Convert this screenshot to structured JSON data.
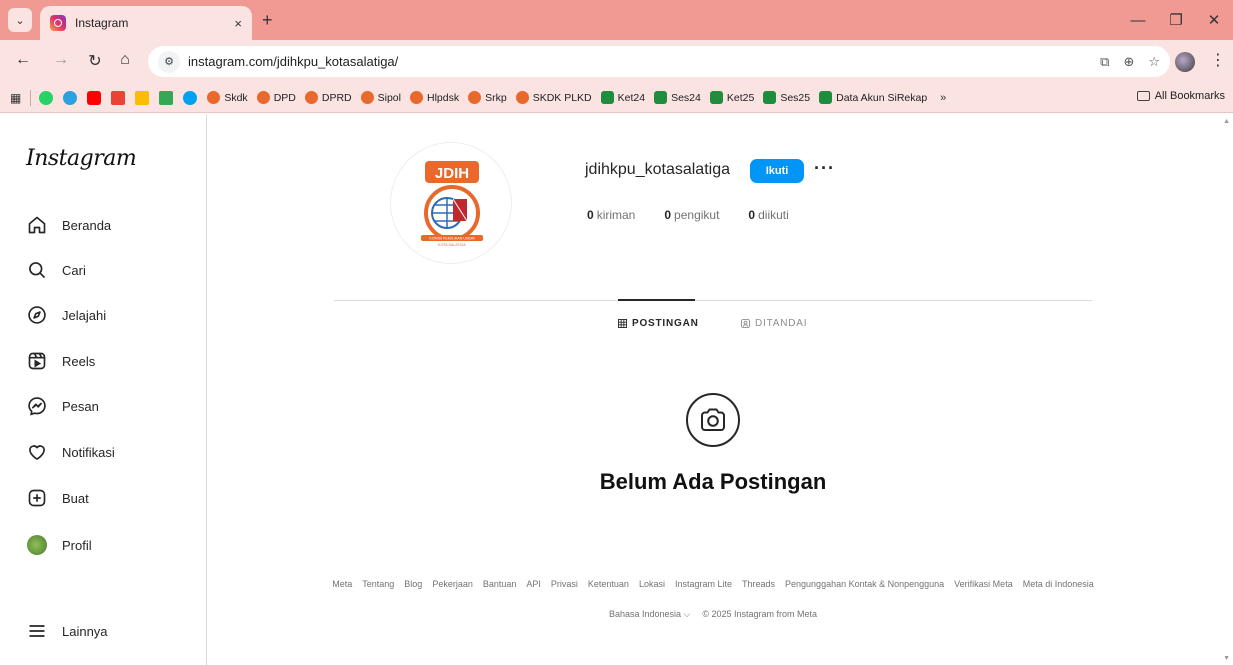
{
  "browser": {
    "tab_title": "Instagram",
    "tab_close": "×",
    "new_tab": "+",
    "window_controls": {
      "minimize": "—",
      "restore": "❐",
      "close": "✕"
    },
    "url": "instagram.com/jdihkpu_kotasalatiga/",
    "bookmarks": [
      {
        "label": "Skdk",
        "icon": "kpu"
      },
      {
        "label": "DPD",
        "icon": "kpu"
      },
      {
        "label": "DPRD",
        "icon": "kpu"
      },
      {
        "label": "Sipol",
        "icon": "kpu"
      },
      {
        "label": "Hlpdsk",
        "icon": "kpu"
      },
      {
        "label": "Srkp",
        "icon": "kpu"
      },
      {
        "label": "SKDK PLKD",
        "icon": "kpu"
      },
      {
        "label": "Ket24",
        "icon": "sheet"
      },
      {
        "label": "Ses24",
        "icon": "sheet"
      },
      {
        "label": "Ket25",
        "icon": "sheet"
      },
      {
        "label": "Ses25",
        "icon": "sheet"
      },
      {
        "label": "Data Akun SiRekap",
        "icon": "sheet"
      }
    ],
    "bookmarks_more": "»",
    "all_bookmarks": "All Bookmarks"
  },
  "sidebar": {
    "logo": "Instagram",
    "items": [
      {
        "label": "Beranda",
        "icon": "home-icon"
      },
      {
        "label": "Cari",
        "icon": "search-icon"
      },
      {
        "label": "Jelajahi",
        "icon": "compass-icon"
      },
      {
        "label": "Reels",
        "icon": "reels-icon"
      },
      {
        "label": "Pesan",
        "icon": "messenger-icon"
      },
      {
        "label": "Notifikasi",
        "icon": "heart-icon"
      },
      {
        "label": "Buat",
        "icon": "plus-square-icon"
      },
      {
        "label": "Profil",
        "icon": "avatar"
      }
    ],
    "more": "Lainnya"
  },
  "profile": {
    "avatar_text": "JDIH",
    "avatar_caption": "KOMISI PEMILIHAN UMUM",
    "avatar_caption2": "KOTA SALATIGA",
    "username": "jdihkpu_kotasalatiga",
    "follow_label": "Ikuti",
    "more_label": "···",
    "stats": {
      "posts_count": "0",
      "posts_label": "kiriman",
      "followers_count": "0",
      "followers_label": "pengikut",
      "following_count": "0",
      "following_label": "diikuti"
    },
    "tabs": {
      "posts": "POSTINGAN",
      "tagged": "DITANDAI"
    },
    "empty_title": "Belum Ada Postingan"
  },
  "footer": {
    "links": [
      "Meta",
      "Tentang",
      "Blog",
      "Pekerjaan",
      "Bantuan",
      "API",
      "Privasi",
      "Ketentuan",
      "Lokasi",
      "Instagram Lite",
      "Threads",
      "Pengunggahan Kontak & Nonpengguna",
      "Verifikasi Meta",
      "Meta di Indonesia"
    ],
    "language": "Bahasa Indonesia",
    "copyright": "© 2025 Instagram from Meta"
  },
  "colors": {
    "accent": "#0095f6",
    "tabstrip": "#f09a93",
    "toolbar": "#fbe3e1"
  }
}
